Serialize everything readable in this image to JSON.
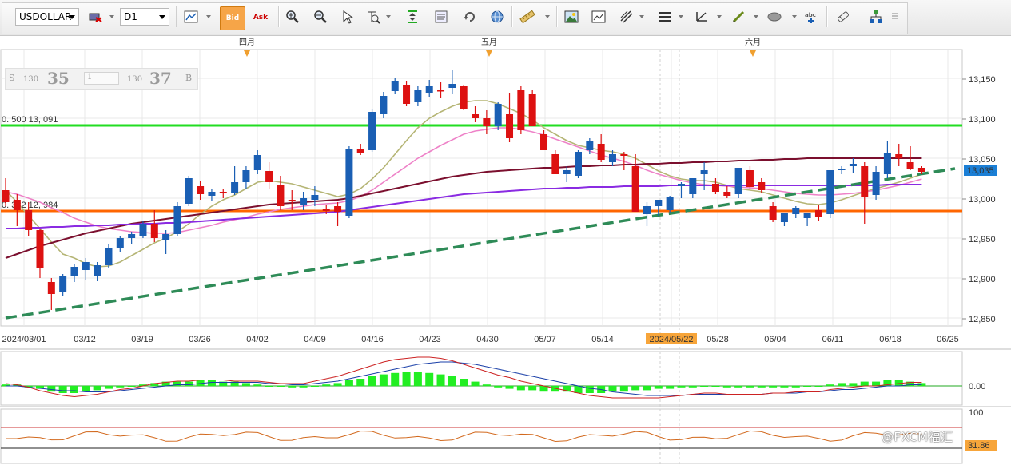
{
  "toolbar": {
    "symbol": "USDOLLAR",
    "timeframe": "D1",
    "bid_label": "Bid",
    "ask_label": "Ask",
    "icons": [
      "price-link-icon",
      "bar-chart-icon",
      "bid-icon",
      "ask-icon",
      "zoom-in-icon",
      "zoom-out-icon",
      "cursor-icon",
      "data-window-icon",
      "auto-scroll-icon",
      "properties-icon",
      "refresh-icon",
      "globe-icon",
      "ruler-icon",
      "screenshot-icon",
      "template-icon",
      "drawing-tools-icon",
      "indicators-icon",
      "trendline-icon",
      "pen-icon",
      "shape-icon",
      "text-icon",
      "eraser-icon",
      "layout-icon",
      "menu-icon"
    ]
  },
  "quote_box": {
    "sell_label": "S",
    "sell_prefix": "130",
    "sell_big": "35",
    "lot": "1",
    "buy_prefix": "130",
    "buy_big": "37",
    "buy_label": "B"
  },
  "price_axis": {
    "ticks": [
      "13,150",
      "13,100",
      "13,050",
      "13,000",
      "12,950",
      "12,900",
      "12,850"
    ],
    "current_price": "13,035"
  },
  "date_axis": {
    "labels": [
      "2024/03/01",
      "03/12",
      "03/19",
      "03/26",
      "04/02",
      "04/09",
      "04/16",
      "04/23",
      "04/30",
      "05/07",
      "05/14",
      "2024/05/22",
      "05/28",
      "06/04",
      "06/11",
      "06/18",
      "06/25"
    ],
    "highlight": "2024/05/22"
  },
  "month_markers": [
    "四月",
    "五月",
    "六月"
  ],
  "levels": [
    {
      "label": "0. 500  13, 091",
      "price": 13091,
      "color": "#22dd22"
    },
    {
      "label": "0. 382  12, 984",
      "price": 12984,
      "color": "#ff6600"
    }
  ],
  "macd_panel": {
    "zero_label": "0.00"
  },
  "rsi_panel": {
    "top_label": "100",
    "value_label": "31.86"
  },
  "watermark": "@FXCM福汇",
  "colors": {
    "up": "#1a5fb4",
    "down": "#dd1111",
    "green_level": "#22dd22",
    "orange_level": "#ff6600",
    "trend": "#2e8b57",
    "ma_short": "#b5b575",
    "ma_mid": "#ee82c8",
    "ma_long": "#7b0f2e",
    "ma_purple": "#8a2be2"
  },
  "chart_data": {
    "type": "candlestick",
    "symbol": "USDOLLAR",
    "timeframe": "D1",
    "ylim": [
      12840,
      13190
    ],
    "candles": [
      [
        13010,
        13025,
        12990,
        12995
      ],
      [
        12998,
        13005,
        12965,
        12985
      ],
      [
        12985,
        12995,
        12952,
        12960
      ],
      [
        12960,
        12962,
        12900,
        12912
      ],
      [
        12895,
        12900,
        12860,
        12880
      ],
      [
        12882,
        12905,
        12878,
        12903
      ],
      [
        12903,
        12918,
        12895,
        12914
      ],
      [
        12910,
        12925,
        12898,
        12920
      ],
      [
        12902,
        12920,
        12896,
        12916
      ],
      [
        12916,
        12942,
        12912,
        12938
      ],
      [
        12938,
        12953,
        12932,
        12950
      ],
      [
        12950,
        12958,
        12943,
        12955
      ],
      [
        12953,
        12972,
        12950,
        12968
      ],
      [
        12968,
        12985,
        12945,
        12950
      ],
      [
        12948,
        12960,
        12930,
        12955
      ],
      [
        12955,
        12995,
        12952,
        12990
      ],
      [
        12993,
        13028,
        12990,
        13025
      ],
      [
        13015,
        13022,
        12998,
        13005
      ],
      [
        13003,
        13012,
        12996,
        13008
      ],
      [
        13008,
        13012,
        13000,
        13006
      ],
      [
        13006,
        13040,
        13004,
        13020
      ],
      [
        13020,
        13040,
        13012,
        13035
      ],
      [
        13035,
        13060,
        13030,
        13054
      ],
      [
        13034,
        13045,
        13012,
        13020
      ],
      [
        13017,
        13028,
        12985,
        12990
      ],
      [
        12998,
        13010,
        12985,
        12997
      ],
      [
        12992,
        13008,
        12985,
        13000
      ],
      [
        12998,
        13015,
        12990,
        13004
      ],
      [
        12986,
        12992,
        12980,
        12984
      ],
      [
        12990,
        12995,
        12965,
        12983
      ],
      [
        12978,
        13065,
        12975,
        13062
      ],
      [
        13062,
        13068,
        13054,
        13056
      ],
      [
        13060,
        13111,
        13058,
        13108
      ],
      [
        13105,
        13133,
        13100,
        13128
      ],
      [
        13134,
        13150,
        13130,
        13147
      ],
      [
        13142,
        13146,
        13115,
        13118
      ],
      [
        13120,
        13140,
        13115,
        13135
      ],
      [
        13132,
        13148,
        13126,
        13140
      ],
      [
        13135,
        13145,
        13125,
        13134
      ],
      [
        13138,
        13160,
        13130,
        13143
      ],
      [
        13140,
        13142,
        13110,
        13112
      ],
      [
        13105,
        13115,
        13095,
        13100
      ],
      [
        13100,
        13110,
        13080,
        13090
      ],
      [
        13090,
        13120,
        13085,
        13118
      ],
      [
        13105,
        13132,
        13070,
        13075
      ],
      [
        13135,
        13140,
        13080,
        13085
      ],
      [
        13130,
        13135,
        13090,
        13090
      ],
      [
        13080,
        13085,
        13065,
        13060
      ],
      [
        13055,
        13060,
        13030,
        13030
      ],
      [
        13030,
        13040,
        13020,
        13035
      ],
      [
        13028,
        13060,
        13025,
        13058
      ],
      [
        13060,
        13075,
        13055,
        13072
      ],
      [
        13068,
        13080,
        13045,
        13048
      ],
      [
        13045,
        13060,
        13040,
        13055
      ],
      [
        13055,
        13058,
        13035,
        13053
      ],
      [
        13040,
        13055,
        12983,
        12983
      ],
      [
        12980,
        12995,
        12965,
        12990
      ],
      [
        12990,
        12998,
        12978,
        12998
      ],
      [
        12985,
        13003,
        12982,
        13002
      ],
      [
        13015,
        13020,
        13000,
        13018
      ],
      [
        13005,
        13022,
        13000,
        13025
      ],
      [
        13030,
        13045,
        13010,
        13035
      ],
      [
        13018,
        13025,
        13005,
        13008
      ],
      [
        13008,
        13015,
        13000,
        13003
      ],
      [
        13005,
        13025,
        13000,
        13038
      ],
      [
        13035,
        13040,
        13012,
        13014
      ],
      [
        13020,
        13025,
        13006,
        13010
      ],
      [
        12990,
        12995,
        12970,
        12973
      ],
      [
        12970,
        12975,
        12965,
        12981
      ],
      [
        12980,
        12990,
        12975,
        12988
      ],
      [
        12975,
        12982,
        12965,
        12982
      ],
      [
        12985,
        12992,
        12972,
        12977
      ],
      [
        12980,
        13035,
        12975,
        13035
      ],
      [
        13035,
        13040,
        13030,
        13037
      ],
      [
        13040,
        13050,
        13032,
        13043
      ],
      [
        13040,
        13045,
        12968,
        13002
      ],
      [
        13004,
        13040,
        12998,
        13033
      ],
      [
        13030,
        13072,
        13025,
        13057
      ],
      [
        13055,
        13068,
        13040,
        13050
      ],
      [
        13045,
        13065,
        13035,
        13036
      ],
      [
        13038,
        13040,
        13030,
        13033
      ]
    ],
    "moving_averages": [
      {
        "name": "short",
        "values": [
          13010,
          12995,
          12978,
          12962,
          12945,
          12930,
          12925,
          12918,
          12914,
          12915,
          12920,
          12928,
          12936,
          12944,
          12950,
          12958,
          12968,
          12980,
          12990,
          12998,
          13004,
          13012,
          13020,
          13022,
          13020,
          13018,
          13014,
          13010,
          13006,
          13002,
          13005,
          13012,
          13024,
          13038,
          13055,
          13072,
          13088,
          13100,
          13108,
          13115,
          13120,
          13122,
          13122,
          13118,
          13112,
          13106,
          13098,
          13088,
          13080,
          13072,
          13066,
          13063,
          13060,
          13058,
          13055,
          13050,
          13042,
          13034,
          13028,
          13024,
          13022,
          13022,
          13020,
          13016,
          13012,
          13010,
          13008,
          13004,
          13000,
          12996,
          12993,
          12992,
          12994,
          12998,
          13003,
          13008,
          13012,
          13016,
          13020,
          13025,
          13030
        ]
      },
      {
        "name": "mid",
        "values": [
          13008,
          13005,
          13000,
          12995,
          12988,
          12982,
          12975,
          12970,
          12965,
          12962,
          12960,
          12958,
          12957,
          12956,
          12956,
          12957,
          12960,
          12963,
          12966,
          12970,
          12973,
          12976,
          12980,
          12983,
          12986,
          12988,
          12990,
          12992,
          12993,
          12994,
          12997,
          13002,
          13010,
          13020,
          13030,
          13040,
          13050,
          13058,
          13066,
          13073,
          13080,
          13084,
          13086,
          13088,
          13088,
          13086,
          13083,
          13079,
          13074,
          13069,
          13064,
          13059,
          13054,
          13050,
          13046,
          13041,
          13035,
          13030,
          13026,
          13022,
          13019,
          13017,
          13016,
          13015,
          13014,
          13013,
          13012,
          13010,
          13008,
          13006,
          13005,
          13004,
          13004,
          13005,
          13006,
          13008,
          13010,
          13013,
          13016,
          13020,
          13024
        ]
      },
      {
        "name": "long",
        "values": [
          12925,
          12930,
          12935,
          12940,
          12944,
          12948,
          12952,
          12956,
          12959,
          12962,
          12965,
          12968,
          12970,
          12972,
          12974,
          12976,
          12978,
          12980,
          12982,
          12984,
          12986,
          12988,
          12990,
          12992,
          12993,
          12994,
          12995,
          12996,
          12997,
          12998,
          13000,
          13003,
          13006,
          13009,
          13012,
          13015,
          13018,
          13021,
          13024,
          13027,
          13029,
          13031,
          13033,
          13034,
          13035,
          13036,
          13037,
          13038,
          13038,
          13039,
          13040,
          13040,
          13041,
          13041,
          13042,
          13042,
          13043,
          13043,
          13044,
          13044,
          13045,
          13045,
          13046,
          13046,
          13047,
          13047,
          13048,
          13048,
          13049,
          13049,
          13050,
          13050,
          13050,
          13050,
          13050,
          13050,
          13050,
          13050,
          13050,
          13050,
          13050
        ]
      },
      {
        "name": "purple",
        "values": [
          12962,
          12962,
          12963,
          12963,
          12964,
          12964,
          12965,
          12965,
          12966,
          12966,
          12967,
          12967,
          12968,
          12968,
          12969,
          12969,
          12970,
          12971,
          12972,
          12973,
          12974,
          12975,
          12976,
          12977,
          12978,
          12979,
          12980,
          12981,
          12982,
          12983,
          12985,
          12987,
          12989,
          12991,
          12993,
          12995,
          12997,
          12999,
          13001,
          13003,
          13005,
          13006,
          13007,
          13008,
          13009,
          13010,
          13011,
          13012,
          13012,
          13013,
          13013,
          13014,
          13014,
          13014,
          13015,
          13015,
          13015,
          13015,
          13016,
          13016,
          13016,
          13016,
          13016,
          13016,
          13016,
          13016,
          13016,
          13016,
          13016,
          13016,
          13016,
          13016,
          13016,
          13016,
          13016,
          13016,
          13016,
          13017,
          13017,
          13017,
          13017
        ]
      }
    ],
    "trendline": {
      "style": "dashed",
      "from": [
        0,
        12850
      ],
      "to": [
        80,
        13030
      ]
    },
    "levels": [
      13091,
      12984
    ],
    "macd": {
      "histogram": [
        1,
        1,
        -1,
        -2,
        -4,
        -5,
        -5,
        -4,
        -3,
        -2,
        -1,
        0,
        1,
        2,
        3,
        3,
        3,
        4,
        4,
        3,
        3,
        2,
        1,
        0,
        0,
        -1,
        -1,
        0,
        1,
        2,
        4,
        5,
        7,
        8,
        9,
        10,
        10,
        9,
        8,
        7,
        5,
        3,
        1,
        -1,
        -2,
        -3,
        -3,
        -4,
        -4,
        -4,
        -5,
        -5,
        -5,
        -4,
        -4,
        -3,
        -3,
        -2,
        -2,
        -1,
        -1,
        0,
        0,
        -1,
        -1,
        -1,
        -1,
        -1,
        -1,
        -1,
        0,
        0,
        1,
        2,
        2,
        3,
        3,
        4,
        4,
        3,
        2
      ],
      "signal": [
        0,
        0,
        -1,
        -2,
        -3,
        -4,
        -4,
        -5,
        -5,
        -5,
        -4,
        -3,
        -2,
        -1,
        0,
        1,
        1,
        2,
        3,
        3,
        3,
        3,
        3,
        2,
        2,
        1,
        1,
        2,
        3,
        4,
        6,
        8,
        10,
        12,
        14,
        16,
        18,
        19,
        20,
        20,
        19,
        18,
        16,
        14,
        12,
        10,
        8,
        6,
        4,
        2,
        0,
        -2,
        -3,
        -5,
        -6,
        -7,
        -8,
        -8,
        -8,
        -8,
        -7,
        -7,
        -7,
        -7,
        -7,
        -7,
        -7,
        -6,
        -6,
        -6,
        -5,
        -5,
        -4,
        -3,
        -3,
        -2,
        -1,
        0,
        0,
        1,
        1
      ],
      "macd": [
        2,
        1,
        -1,
        -4,
        -6,
        -8,
        -9,
        -8,
        -7,
        -5,
        -3,
        -2,
        0,
        2,
        3,
        4,
        4,
        5,
        5,
        5,
        4,
        4,
        4,
        3,
        2,
        2,
        2,
        4,
        6,
        8,
        11,
        14,
        17,
        20,
        22,
        23,
        24,
        24,
        23,
        21,
        18,
        15,
        12,
        9,
        7,
        4,
        2,
        0,
        -2,
        -4,
        -6,
        -8,
        -9,
        -10,
        -10,
        -10,
        -10,
        -10,
        -9,
        -8,
        -7,
        -6,
        -6,
        -7,
        -7,
        -7,
        -7,
        -6,
        -6,
        -5,
        -5,
        -5,
        -3,
        -2,
        -1,
        0,
        0,
        1,
        2,
        3,
        3
      ],
      "zero": 0
    },
    "rsi": {
      "ylim": [
        0,
        100
      ],
      "value": 31.86,
      "levels": [
        100,
        70,
        30,
        0
      ]
    }
  }
}
